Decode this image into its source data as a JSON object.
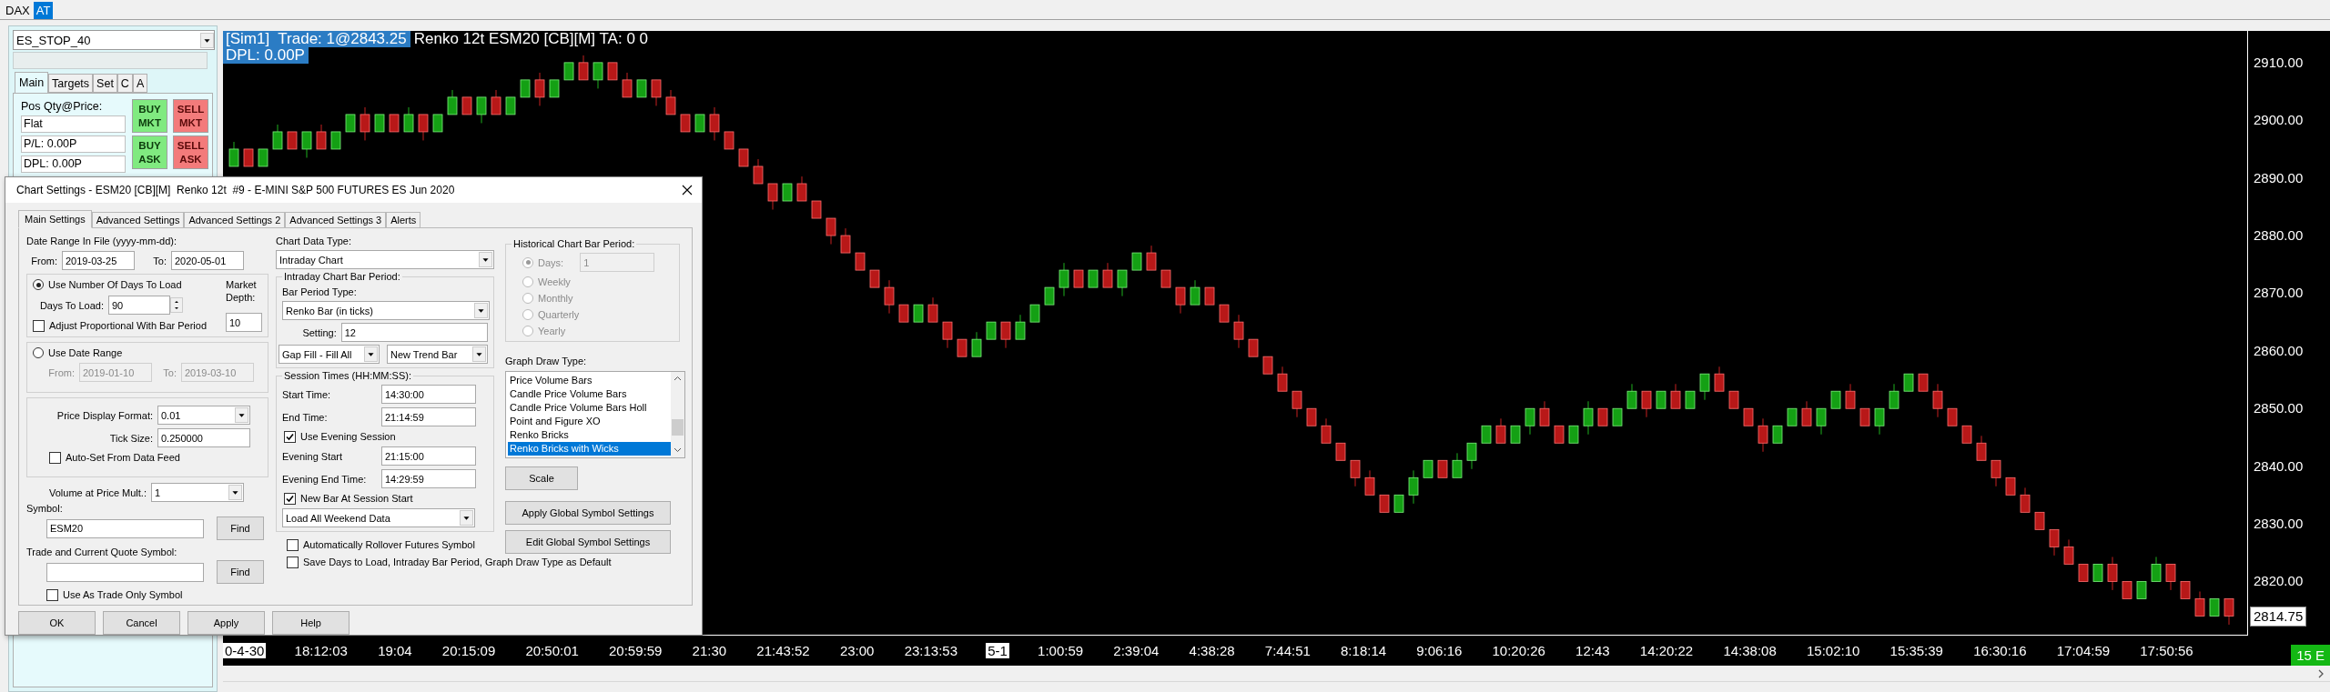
{
  "top_tabs": [
    {
      "label": "DAX",
      "selected": false
    },
    {
      "label": "AT",
      "selected": true
    }
  ],
  "trade_panel": {
    "strategy": "ES_STOP_40",
    "tabs": [
      {
        "label": "Main",
        "selected": true
      },
      {
        "label": "Targets",
        "selected": false
      },
      {
        "label": "Set",
        "selected": false
      },
      {
        "label": "C",
        "selected": false
      },
      {
        "label": "A",
        "selected": false
      }
    ],
    "pos_label": "Pos Qty@Price:",
    "fields": [
      "Flat",
      "P/L: 0.00P",
      "DPL: 0.00P"
    ],
    "buttons": [
      {
        "label": "BUY MKT",
        "kind": "buy"
      },
      {
        "label": "SELL MKT",
        "kind": "sell"
      },
      {
        "label": "BUY ASK",
        "kind": "buy"
      },
      {
        "label": "SELL ASK",
        "kind": "sell"
      }
    ]
  },
  "chart": {
    "header": {
      "trade": "[Sim1]  Trade: 1@2843.25",
      "info": "Renko 12t ESM20 [CB][M] TA: 0 0",
      "dpl": "DPL: 0.00P"
    },
    "chart_data": {
      "type": "candlestick",
      "ylim": [
        2810.6,
        2915.5
      ],
      "ohlc": [
        [
          2892,
          2896.25,
          2892,
          2895
        ],
        [
          2895,
          2895,
          2892,
          2892
        ],
        [
          2892,
          2895,
          2892,
          2895
        ],
        [
          2895,
          2899.25,
          2895,
          2898
        ],
        [
          2898,
          2898,
          2895,
          2895
        ],
        [
          2895,
          2898,
          2893.5,
          2898
        ],
        [
          2898,
          2899.25,
          2895,
          2895
        ],
        [
          2895,
          2898,
          2895,
          2898
        ],
        [
          2898,
          2901,
          2898,
          2901
        ],
        [
          2901,
          2902.25,
          2896.5,
          2898
        ],
        [
          2898,
          2901,
          2898,
          2901
        ],
        [
          2901,
          2901,
          2898,
          2898
        ],
        [
          2898,
          2902.25,
          2898,
          2901
        ],
        [
          2901,
          2901,
          2896.5,
          2898
        ],
        [
          2898,
          2901,
          2898,
          2901
        ],
        [
          2901,
          2905.25,
          2901,
          2904
        ],
        [
          2904,
          2904,
          2901,
          2901
        ],
        [
          2901,
          2904,
          2899.5,
          2904
        ],
        [
          2904,
          2905.25,
          2901,
          2901
        ],
        [
          2901,
          2904,
          2901,
          2904
        ],
        [
          2904,
          2907,
          2904,
          2907
        ],
        [
          2907,
          2908.25,
          2902.5,
          2904
        ],
        [
          2904,
          2907,
          2904,
          2907
        ],
        [
          2907,
          2910,
          2907,
          2910
        ],
        [
          2910,
          2911.25,
          2907,
          2907
        ],
        [
          2907,
          2910,
          2905.5,
          2910
        ],
        [
          2910,
          2910,
          2907,
          2907
        ],
        [
          2907,
          2908.25,
          2904,
          2904
        ],
        [
          2904,
          2907,
          2904,
          2907
        ],
        [
          2907,
          2907,
          2902.5,
          2904
        ],
        [
          2904,
          2905.25,
          2901,
          2901
        ],
        [
          2901,
          2901,
          2898,
          2898
        ],
        [
          2898,
          2901,
          2898,
          2901
        ],
        [
          2901,
          2902.25,
          2896.5,
          2898
        ],
        [
          2898,
          2898,
          2895,
          2895
        ],
        [
          2895,
          2895,
          2892,
          2892
        ],
        [
          2892,
          2893.25,
          2889,
          2889
        ],
        [
          2889,
          2889,
          2884.5,
          2886
        ],
        [
          2886,
          2889,
          2886,
          2889
        ],
        [
          2889,
          2890.25,
          2886,
          2886
        ],
        [
          2886,
          2886,
          2883,
          2883
        ],
        [
          2883,
          2883,
          2878.5,
          2880
        ],
        [
          2880,
          2881.25,
          2877,
          2877
        ],
        [
          2877,
          2877,
          2874,
          2874
        ],
        [
          2874,
          2874,
          2871,
          2871
        ],
        [
          2871,
          2872.25,
          2866.5,
          2868
        ],
        [
          2868,
          2868,
          2865,
          2865
        ],
        [
          2865,
          2868,
          2865,
          2868
        ],
        [
          2868,
          2869.25,
          2865,
          2865
        ],
        [
          2865,
          2865,
          2860.5,
          2862
        ],
        [
          2862,
          2862,
          2859,
          2859
        ],
        [
          2859,
          2863.25,
          2859,
          2862
        ],
        [
          2862,
          2865,
          2862,
          2865
        ],
        [
          2865,
          2865,
          2860.5,
          2862
        ],
        [
          2862,
          2866.25,
          2862,
          2865
        ],
        [
          2865,
          2868,
          2865,
          2868
        ],
        [
          2868,
          2871,
          2868,
          2871
        ],
        [
          2871,
          2875.25,
          2869.5,
          2874
        ],
        [
          2874,
          2874,
          2871,
          2871
        ],
        [
          2871,
          2874,
          2871,
          2874
        ],
        [
          2874,
          2875.25,
          2871,
          2871
        ],
        [
          2871,
          2874,
          2869.5,
          2874
        ],
        [
          2874,
          2877,
          2874,
          2877
        ],
        [
          2877,
          2878.25,
          2874,
          2874
        ],
        [
          2874,
          2874,
          2871,
          2871
        ],
        [
          2871,
          2871,
          2866.5,
          2868
        ],
        [
          2868,
          2872.25,
          2868,
          2871
        ],
        [
          2871,
          2871,
          2868,
          2868
        ],
        [
          2868,
          2868,
          2865,
          2865
        ],
        [
          2865,
          2866.25,
          2860.5,
          2862
        ],
        [
          2862,
          2862,
          2859,
          2859
        ],
        [
          2859,
          2859,
          2856,
          2856
        ],
        [
          2856,
          2857.25,
          2853,
          2853
        ],
        [
          2853,
          2853,
          2848.5,
          2850
        ],
        [
          2850,
          2850,
          2847,
          2847
        ],
        [
          2847,
          2848.25,
          2844,
          2844
        ],
        [
          2844,
          2844,
          2841,
          2841
        ],
        [
          2841,
          2841,
          2836.5,
          2838
        ],
        [
          2838,
          2839.25,
          2835,
          2835
        ],
        [
          2835,
          2835,
          2832,
          2832
        ],
        [
          2832,
          2835,
          2832,
          2835
        ],
        [
          2835,
          2839.25,
          2833.5,
          2838
        ],
        [
          2838,
          2841,
          2838,
          2841
        ],
        [
          2841,
          2841,
          2838,
          2838
        ],
        [
          2838,
          2842.25,
          2838,
          2841
        ],
        [
          2841,
          2844,
          2839.5,
          2844
        ],
        [
          2844,
          2847,
          2844,
          2847
        ],
        [
          2847,
          2848.25,
          2844,
          2844
        ],
        [
          2844,
          2847,
          2844,
          2847
        ],
        [
          2847,
          2850,
          2845.5,
          2850
        ],
        [
          2850,
          2851.25,
          2847,
          2847
        ],
        [
          2847,
          2847,
          2844,
          2844
        ],
        [
          2844,
          2847,
          2844,
          2847
        ],
        [
          2847,
          2851.25,
          2845.5,
          2850
        ],
        [
          2850,
          2850,
          2847,
          2847
        ],
        [
          2847,
          2850,
          2847,
          2850
        ],
        [
          2850,
          2854.25,
          2850,
          2853
        ],
        [
          2853,
          2853,
          2848.5,
          2850
        ],
        [
          2850,
          2853,
          2850,
          2853
        ],
        [
          2853,
          2854.25,
          2850,
          2850
        ],
        [
          2850,
          2853,
          2850,
          2853
        ],
        [
          2853,
          2856,
          2851.5,
          2856
        ],
        [
          2856,
          2857.25,
          2853,
          2853
        ],
        [
          2853,
          2853,
          2850,
          2850
        ],
        [
          2850,
          2850,
          2847,
          2847
        ],
        [
          2847,
          2848.25,
          2842.5,
          2844
        ],
        [
          2844,
          2847,
          2844,
          2847
        ],
        [
          2847,
          2850,
          2847,
          2850
        ],
        [
          2850,
          2851.25,
          2847,
          2847
        ],
        [
          2847,
          2850,
          2845.5,
          2850
        ],
        [
          2850,
          2853,
          2850,
          2853
        ],
        [
          2853,
          2854.25,
          2850,
          2850
        ],
        [
          2850,
          2850,
          2847,
          2847
        ],
        [
          2847,
          2850,
          2845.5,
          2850
        ],
        [
          2850,
          2854.25,
          2850,
          2853
        ],
        [
          2853,
          2856,
          2853,
          2856
        ],
        [
          2856,
          2856,
          2853,
          2853
        ],
        [
          2853,
          2854.25,
          2848.5,
          2850
        ],
        [
          2850,
          2850,
          2847,
          2847
        ],
        [
          2847,
          2847,
          2844,
          2844
        ],
        [
          2844,
          2845.25,
          2841,
          2841
        ],
        [
          2841,
          2841,
          2836.5,
          2838
        ],
        [
          2838,
          2838,
          2835,
          2835
        ],
        [
          2835,
          2836.25,
          2832,
          2832
        ],
        [
          2832,
          2832,
          2829,
          2829
        ],
        [
          2829,
          2829,
          2824.5,
          2826
        ],
        [
          2826,
          2827.25,
          2823,
          2823
        ],
        [
          2823,
          2823,
          2820,
          2820
        ],
        [
          2820,
          2823,
          2820,
          2823
        ],
        [
          2823,
          2824.25,
          2818.5,
          2820
        ],
        [
          2820,
          2820,
          2817,
          2817
        ],
        [
          2817,
          2820,
          2817,
          2820
        ],
        [
          2820,
          2824.25,
          2820,
          2823
        ],
        [
          2823,
          2823,
          2818.5,
          2820
        ],
        [
          2820,
          2820,
          2817,
          2817
        ],
        [
          2817,
          2818.25,
          2814,
          2814
        ],
        [
          2814,
          2817,
          2814,
          2817
        ],
        [
          2817,
          2817,
          2812.5,
          2814
        ]
      ],
      "yticks": [
        {
          "value": 2910,
          "label": "2910.00"
        },
        {
          "value": 2900,
          "label": "2900.00"
        },
        {
          "value": 2890,
          "label": "2890.00"
        },
        {
          "value": 2880,
          "label": "2880.00"
        },
        {
          "value": 2870,
          "label": "2870.00"
        },
        {
          "value": 2860,
          "label": "2860.00"
        },
        {
          "value": 2850,
          "label": "2850.00"
        },
        {
          "value": 2840,
          "label": "2840.00"
        },
        {
          "value": 2830,
          "label": "2830.00"
        },
        {
          "value": 2820,
          "label": "2820.00"
        }
      ]
    },
    "last_price": "2814.75",
    "time_labels": [
      {
        "label": "0-4-30",
        "kind": "date"
      },
      {
        "label": "18:12:03",
        "kind": "time"
      },
      {
        "label": "19:04",
        "kind": "time"
      },
      {
        "label": "20:15:09",
        "kind": "time"
      },
      {
        "label": "20:50:01",
        "kind": "time"
      },
      {
        "label": "20:59:59",
        "kind": "time"
      },
      {
        "label": "21:30",
        "kind": "time"
      },
      {
        "label": "21:43:52",
        "kind": "time"
      },
      {
        "label": "23:00",
        "kind": "time"
      },
      {
        "label": "23:13:53",
        "kind": "time"
      },
      {
        "label": "5-1",
        "kind": "date"
      },
      {
        "label": "1:00:59",
        "kind": "time"
      },
      {
        "label": "2:39:04",
        "kind": "time"
      },
      {
        "label": "4:38:28",
        "kind": "time"
      },
      {
        "label": "7:44:51",
        "kind": "time"
      },
      {
        "label": "8:18:14",
        "kind": "time"
      },
      {
        "label": "9:06:16",
        "kind": "time"
      },
      {
        "label": "10:20:26",
        "kind": "time"
      },
      {
        "label": "12:43",
        "kind": "time"
      },
      {
        "label": "14:20:22",
        "kind": "time"
      },
      {
        "label": "14:38:08",
        "kind": "time"
      },
      {
        "label": "15:02:10",
        "kind": "time"
      },
      {
        "label": "15:35:39",
        "kind": "time"
      },
      {
        "label": "16:30:16",
        "kind": "time"
      },
      {
        "label": "17:04:59",
        "kind": "time"
      },
      {
        "label": "17:50:56",
        "kind": "time"
      }
    ],
    "corner": "15 E"
  },
  "dialog": {
    "title": "Chart Settings - ESM20 [CB][M]  Renko 12t  #9 - E-MINI S&P 500 FUTURES ES Jun 2020",
    "tabs": [
      {
        "label": "Main Settings",
        "selected": true
      },
      {
        "label": "Advanced Settings",
        "selected": false
      },
      {
        "label": "Advanced Settings 2",
        "selected": false
      },
      {
        "label": "Advanced Settings 3",
        "selected": false
      },
      {
        "label": "Alerts",
        "selected": false
      }
    ],
    "date_range": {
      "label": "Date Range In File (yyyy-mm-dd):",
      "from_label": "From:",
      "from": "2019-03-25",
      "to_label": "To:",
      "to": "2020-05-01"
    },
    "load_days": {
      "label": "Use Number Of Days To Load",
      "selected": true,
      "days_label": "Days To Load:",
      "days": "90",
      "adjust_label": "Adjust Proportional With Bar Period",
      "adjust_checked": false,
      "depth_label": "Market Depth:",
      "depth": "10"
    },
    "date_option": {
      "label": "Use Date Range",
      "selected": false,
      "disabled": true,
      "from_label": "From:",
      "from": "2019-01-10",
      "to_label": "To:",
      "to": "2019-03-10"
    },
    "price": {
      "format_label": "Price Display Format:",
      "format": "0.01",
      "tick_label": "Tick Size:",
      "tick": "0.250000",
      "auto_label": "Auto-Set From Data Feed",
      "auto_checked": false
    },
    "volume": {
      "label": "Volume at Price Mult.:",
      "value": "1"
    },
    "symbol": {
      "label": "Symbol:",
      "value": "ESM20",
      "button": "Find"
    },
    "quote_symbol": {
      "label": "Trade and Current Quote Symbol:",
      "button": "Find"
    },
    "trade_only": {
      "label": "Use As Trade Only Symbol",
      "checked": false
    },
    "chart_data_type": {
      "label": "Chart Data Type:",
      "value": "Intraday Chart"
    },
    "bar_period": {
      "title": "Intraday Chart Bar Period:",
      "type_label": "Bar Period Type:",
      "type": "Renko Bar (in ticks)",
      "setting_label": "Setting:",
      "setting": "12",
      "gap_fill": "Gap Fill - Fill All",
      "new_trend": "New Trend Bar"
    },
    "session": {
      "title": "Session Times (HH:MM:SS):",
      "rows": [
        {
          "kind": "field",
          "label": "Start Time:",
          "value": "14:30:00"
        },
        {
          "kind": "field",
          "label": "End Time:",
          "value": "21:14:59"
        },
        {
          "kind": "check",
          "label": "Use Evening Session",
          "checked": true
        },
        {
          "kind": "field",
          "label": "Evening Start",
          "value": "21:15:00"
        },
        {
          "kind": "field",
          "label": "Evening End Time:",
          "value": "14:29:59"
        },
        {
          "kind": "check",
          "label": "New Bar At Session Start",
          "checked": true
        },
        {
          "kind": "select",
          "value": "Load All Weekend Data"
        }
      ]
    },
    "rollover": {
      "label": "Automatically Rollover Futures Symbol",
      "checked": false
    },
    "save_default": {
      "label": "Save Days to Load, Intraday Bar Period, Graph Draw Type as Default",
      "checked": false
    },
    "historical": {
      "title": "Historical Chart Bar Period:",
      "disabled": true,
      "days": "1",
      "options": [
        {
          "label": "Days:",
          "selected": true
        },
        {
          "label": "Weekly",
          "selected": false
        },
        {
          "label": "Monthly",
          "selected": false
        },
        {
          "label": "Quarterly",
          "selected": false
        },
        {
          "label": "Yearly",
          "selected": false
        }
      ]
    },
    "graph_draw": {
      "label": "Graph Draw Type:",
      "items": [
        {
          "label": "Price Volume Bars",
          "selected": false
        },
        {
          "label": "Candle Price Volume Bars",
          "selected": false
        },
        {
          "label": "Candle Price Volume Bars Holl",
          "selected": false
        },
        {
          "label": "Point and Figure XO",
          "selected": false
        },
        {
          "label": "Renko Bricks",
          "selected": false
        },
        {
          "label": "Renko Bricks with Wicks",
          "selected": true
        }
      ]
    },
    "scale_button": "Scale",
    "global_buttons": [
      "Apply Global Symbol Settings",
      "Edit Global Symbol Settings"
    ],
    "buttons": [
      "OK",
      "Cancel",
      "Apply",
      "Help"
    ]
  }
}
